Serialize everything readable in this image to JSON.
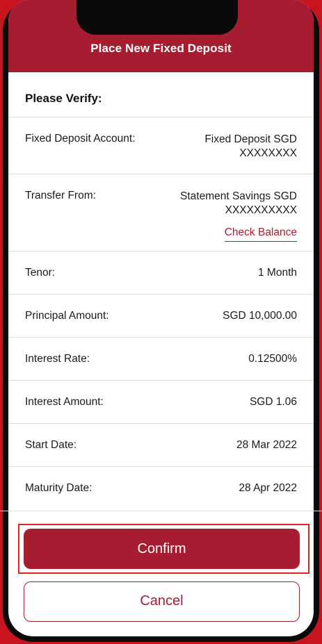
{
  "header": {
    "title": "Place New Fixed Deposit"
  },
  "verify_heading": "Please Verify:",
  "details": {
    "fixed_deposit_account": {
      "label": "Fixed Deposit Account:",
      "value_line1": "Fixed Deposit SGD",
      "value_line2": "XXXXXXXX"
    },
    "transfer_from": {
      "label": "Transfer From:",
      "value_line1": "Statement Savings SGD",
      "value_line2": "XXXXXXXXXX",
      "link": "Check Balance"
    },
    "tenor": {
      "label": "Tenor:",
      "value": "1 Month"
    },
    "principal_amount": {
      "label": "Principal Amount:",
      "value": "SGD 10,000.00"
    },
    "interest_rate": {
      "label": "Interest Rate:",
      "value": "0.12500%"
    },
    "interest_amount": {
      "label": "Interest Amount:",
      "value": "SGD 1.06"
    },
    "start_date": {
      "label": "Start Date:",
      "value": "28 Mar 2022"
    },
    "maturity_date": {
      "label": "Maturity Date:",
      "value": "28 Apr 2022"
    }
  },
  "buttons": {
    "confirm": "Confirm",
    "cancel": "Cancel"
  },
  "colors": {
    "brand": "#a61c30",
    "highlight": "#e2231a",
    "background": "#c8141e"
  }
}
